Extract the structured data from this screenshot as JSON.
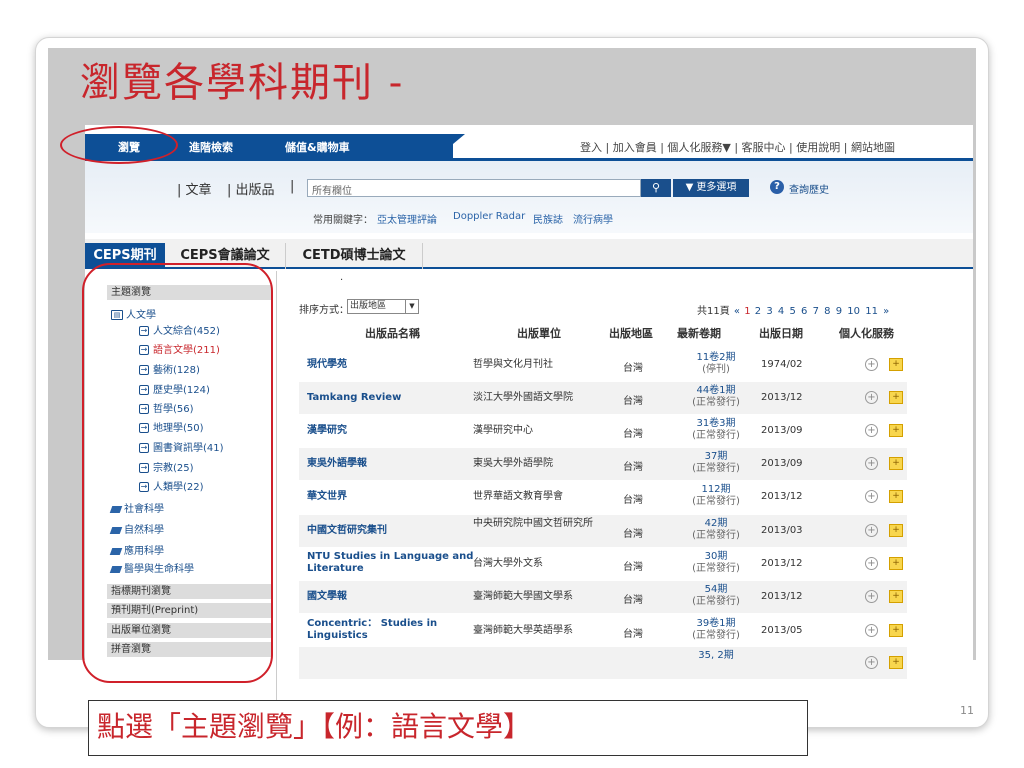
{
  "slide": {
    "title": "瀏覽各學科期刊 -",
    "page_number": "11",
    "caption": "點選「主題瀏覽」【例：語言文學】",
    "annotation_color": "#d0202a"
  },
  "nav": {
    "items": [
      "瀏覽",
      "進階檢索",
      "儲值&購物車"
    ],
    "top_links": "登入 | 加入會員 | 個人化服務▼ | 客服中心 | 使用說明 | 網站地圖"
  },
  "search": {
    "scopes": [
      "| 文章",
      "| 出版品",
      "|"
    ],
    "placeholder": "所有欄位",
    "search_icon": "magnifier-icon",
    "more_label": "▼ 更多選項",
    "help_glyph": "?",
    "history_label": "查詢歷史",
    "keywords_label": "常用關鍵字：",
    "keywords": [
      "亞太管理評論",
      "Doppler Radar",
      "民族誌",
      "流行病學"
    ]
  },
  "tabs": [
    "CEPS期刊",
    "CEPS會議論文",
    "CETD碩博士論文"
  ],
  "sidebar": {
    "topic_header": "主題瀏覽",
    "humanities": "人文學",
    "sub_items": [
      {
        "label": "人文綜合(452)"
      },
      {
        "label": "語言文學(211)"
      },
      {
        "label": "藝術(128)"
      },
      {
        "label": "歷史學(124)"
      },
      {
        "label": "哲學(56)"
      },
      {
        "label": "地理學(50)"
      },
      {
        "label": "圖書資訊學(41)"
      },
      {
        "label": "宗教(25)"
      },
      {
        "label": "人類學(22)"
      }
    ],
    "categories": [
      "社會科學",
      "自然科學",
      "應用科學",
      "醫學與生命科學"
    ],
    "other_headers": [
      "指標期刊瀏覽",
      "預刊期刊(Preprint)",
      "出版單位瀏覽",
      "拼音瀏覽"
    ]
  },
  "results": {
    "sort_label": "排序方式：",
    "sort_value": "出版地區",
    "dot": "·",
    "page_info": "共11頁",
    "pages_prefix": "«",
    "current_page": "1",
    "other_pages": [
      "2",
      "3",
      "4",
      "5",
      "6",
      "7",
      "8",
      "9",
      "10",
      "11"
    ],
    "pages_suffix": "»",
    "headers": [
      "出版品名稱",
      "出版單位",
      "出版地區",
      "最新卷期",
      "出版日期",
      "個人化服務"
    ],
    "rows": [
      {
        "title": "現代學苑",
        "publisher": "哲學與文化月刊社",
        "region": "台灣",
        "issue": "11卷2期",
        "status": "(停刊)",
        "date": "1974/02"
      },
      {
        "title": "Tamkang Review",
        "publisher": "淡江大學外國語文學院",
        "region": "台灣",
        "issue": "44卷1期",
        "status": "(正常發行)",
        "date": "2013/12"
      },
      {
        "title": "漢學研究",
        "publisher": "漢學研究中心",
        "region": "台灣",
        "issue": "31卷3期",
        "status": "(正常發行)",
        "date": "2013/09"
      },
      {
        "title": "東吳外語學報",
        "publisher": "東吳大學外語學院",
        "region": "台灣",
        "issue": "37期",
        "status": "(正常發行)",
        "date": "2013/09"
      },
      {
        "title": "華文世界",
        "publisher": "世界華語文教育學會",
        "region": "台灣",
        "issue": "112期",
        "status": "(正常發行)",
        "date": "2013/12"
      },
      {
        "title": "中國文哲研究集刊",
        "publisher": "中央研究院中國文哲研究所",
        "region": "台灣",
        "issue": "42期",
        "status": "(正常發行)",
        "date": "2013/03"
      },
      {
        "title": "NTU Studies in Language and Literature",
        "publisher": "台灣大學外文系",
        "region": "台灣",
        "issue": "30期",
        "status": "(正常發行)",
        "date": "2013/12"
      },
      {
        "title": "國文學報",
        "publisher": "臺灣師範大學國文學系",
        "region": "台灣",
        "issue": "54期",
        "status": "(正常發行)",
        "date": "2013/12"
      },
      {
        "title": "Concentric： Studies in Linguistics",
        "publisher": "臺灣師範大學英語學系",
        "region": "台灣",
        "issue": "39卷1期",
        "status": "(正常發行)",
        "date": "2013/05"
      },
      {
        "title": "",
        "publisher": "",
        "region": "",
        "issue": "35, 2期",
        "status": "",
        "date": ""
      }
    ],
    "add_glyph": "+",
    "fav_glyph": "+"
  }
}
